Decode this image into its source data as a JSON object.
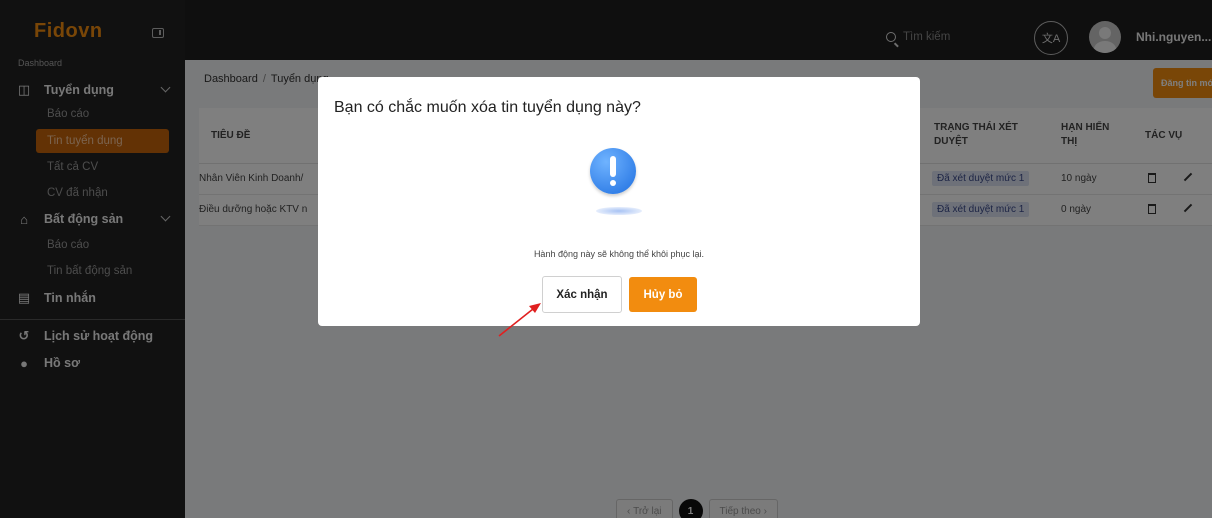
{
  "app": {
    "logo": "Fidovn",
    "accent": "#f28c0f"
  },
  "sidebar": {
    "dashboard_label": "Dashboard",
    "sections": [
      {
        "label": "Tuyển dụng",
        "icon": "briefcase-icon"
      },
      {
        "label": "Bất động sản",
        "icon": "home-icon"
      },
      {
        "label": "Tin nhắn",
        "icon": "message-icon"
      },
      {
        "label": "Lịch sử hoạt động",
        "icon": "history-icon"
      },
      {
        "label": "Hồ sơ",
        "icon": "user-icon"
      }
    ],
    "recruit_items": [
      "Báo cáo",
      "Tin tuyển dụng",
      "Tất cả CV",
      "CV đã nhận"
    ],
    "estate_items": [
      "Báo cáo",
      "Tin bất động sản"
    ]
  },
  "topbar": {
    "search_placeholder": "Tìm kiếm",
    "username": "Nhi.nguyen..."
  },
  "main": {
    "breadcrumb": [
      "Dashboard",
      "Tuyển dụng"
    ],
    "post_button": "Đăng tin mới",
    "columns": [
      "TIÊU ĐỀ",
      "TRẠNG THÁI XÉT DUYỆT",
      "HẠN HIỂN THỊ",
      "TÁC VỤ"
    ],
    "rows": [
      {
        "title": "Nhân Viên Kinh Doanh/",
        "status": "Đã xét duyệt mức 1",
        "duration": "10 ngày"
      },
      {
        "title": "Điều dưỡng hoặc KTV n",
        "status": "Đã xét duyệt mức 1",
        "duration": "0 ngày"
      }
    ],
    "pagination": {
      "prev": "Trở lại",
      "current": "1",
      "next": "Tiếp theo"
    }
  },
  "modal": {
    "title": "Bạn có chắc muốn xóa tin tuyển dụng này?",
    "message": "Hành động này sẽ không thể khôi phục lại.",
    "confirm_label": "Xác nhận",
    "cancel_label": "Hủy bỏ"
  }
}
